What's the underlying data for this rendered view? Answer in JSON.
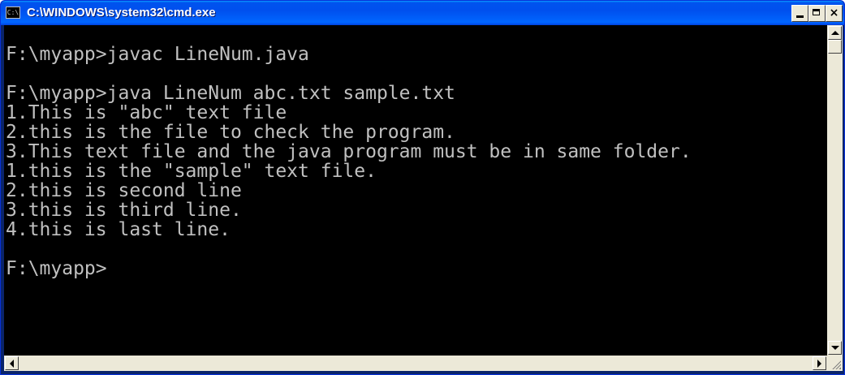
{
  "window": {
    "title": "C:\\WINDOWS\\system32\\cmd.exe",
    "icon_text": "C:\\",
    "icon": "console-app-icon",
    "buttons": {
      "minimize": "minimize-icon",
      "maximize": "maximize-icon",
      "close_label": "×"
    },
    "colors": {
      "titlebar": "#0054e3",
      "console_bg": "#000000",
      "console_fg": "#c0c0c0",
      "chrome": "#ece9d8"
    }
  },
  "console": {
    "lines": [
      "",
      "F:\\myapp>javac LineNum.java",
      "",
      "F:\\myapp>java LineNum abc.txt sample.txt",
      "1.This is \"abc\" text file",
      "2.this is the file to check the program.",
      "3.This text file and the java program must be in same folder.",
      "1.this is the \"sample\" text file.",
      "2.this is second line",
      "3.this is third line.",
      "4.this is last line.",
      "",
      "F:\\myapp>"
    ]
  }
}
